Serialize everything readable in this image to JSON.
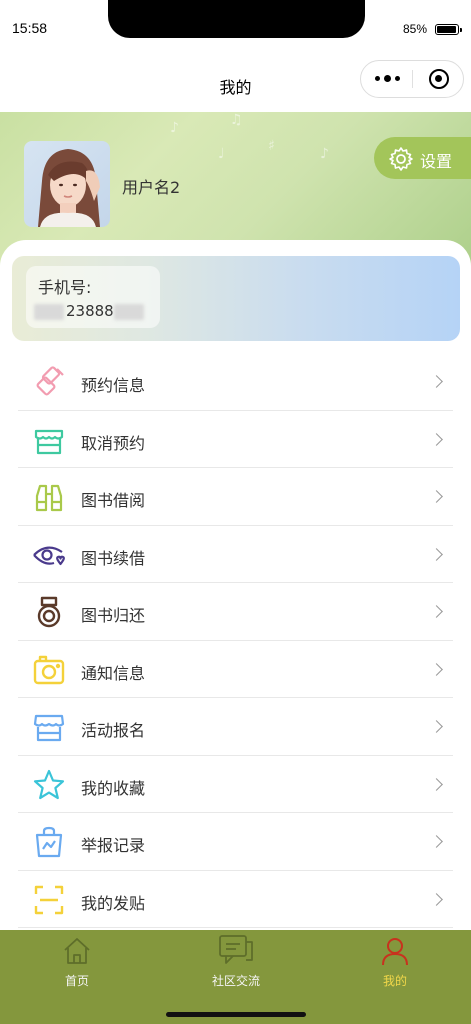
{
  "status": {
    "time": "15:58",
    "battery_pct": "85%",
    "battery_level": 0.85
  },
  "nav": {
    "title": "我的"
  },
  "profile": {
    "username": "用户名2",
    "settings_label": "设置"
  },
  "phone": {
    "label": "手机号:",
    "value": "23888"
  },
  "menu": [
    {
      "label": "预约信息",
      "icon": "brush-icon",
      "color": "#f29cb0"
    },
    {
      "label": "取消预约",
      "icon": "store-icon",
      "color": "#3ec9a0"
    },
    {
      "label": "图书借阅",
      "icon": "binoculars-icon",
      "color": "#a9c94a"
    },
    {
      "label": "图书续借",
      "icon": "eye-heart-icon",
      "color": "#4a3a8c"
    },
    {
      "label": "图书归还",
      "icon": "medal-icon",
      "color": "#5a3a2a"
    },
    {
      "label": "通知信息",
      "icon": "camera-icon",
      "color": "#f4d13a"
    },
    {
      "label": "活动报名",
      "icon": "shop-icon",
      "color": "#6aaaf0"
    },
    {
      "label": "我的收藏",
      "icon": "star-icon",
      "color": "#3ac4d8"
    },
    {
      "label": "举报记录",
      "icon": "bag-chart-icon",
      "color": "#6aaaf0"
    },
    {
      "label": "我的发贴",
      "icon": "scan-icon",
      "color": "#f4d13a"
    }
  ],
  "tabs": [
    {
      "label": "首页",
      "icon": "home-icon",
      "active": false
    },
    {
      "label": "社区交流",
      "icon": "chat-icon",
      "active": false
    },
    {
      "label": "我的",
      "icon": "user-icon",
      "active": true
    }
  ],
  "colors": {
    "tabbar": "#84973d",
    "active_tab": "#f2d84a",
    "settings": "#a3c55a"
  }
}
